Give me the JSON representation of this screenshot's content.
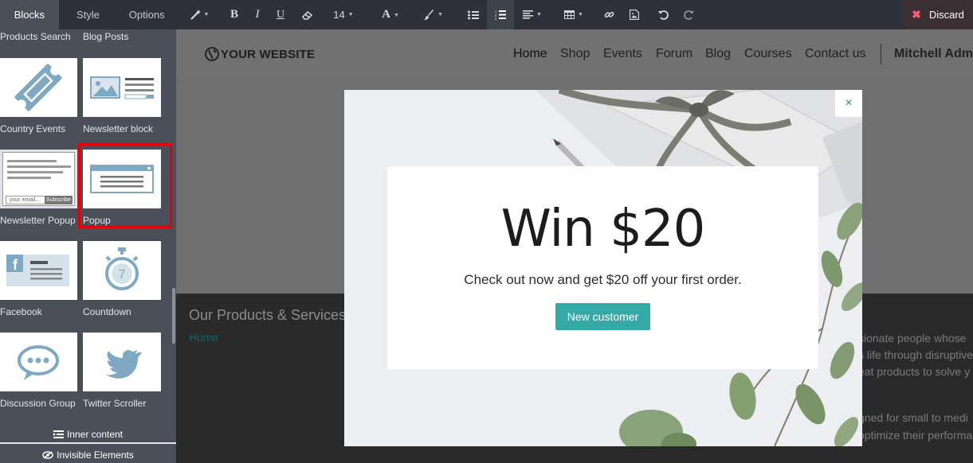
{
  "sidebar": {
    "tabs": [
      "Blocks",
      "Style",
      "Options"
    ],
    "snippets": [
      {
        "label": "Products Search"
      },
      {
        "label": "Blog Posts"
      },
      {
        "label": "Country Events"
      },
      {
        "label": "Newsletter block"
      },
      {
        "label": "Newsletter Popup",
        "email_placeholder": "your email...",
        "subscribe": "Subscribe"
      },
      {
        "label": "Popup"
      },
      {
        "label": "Facebook"
      },
      {
        "label": "Countdown"
      },
      {
        "label": "Discussion Group"
      },
      {
        "label": "Twitter Scroller"
      }
    ],
    "inner_content": "Inner content",
    "invisible_elements": "Invisible Elements"
  },
  "toolbar": {
    "font_size": "14",
    "discard": "Discard"
  },
  "site": {
    "logo": "YOUR WEBSITE",
    "nav": [
      "Home",
      "Shop",
      "Events",
      "Forum",
      "Blog",
      "Courses",
      "Contact us"
    ],
    "user": "Mitchell Admin",
    "section_title": "Our Products & Services",
    "breadcrumb": "Home",
    "side_text": [
      "sionate people whose",
      "s life through disruptive",
      "eat products to solve y",
      "gned for small to medi",
      "optimize their performa"
    ]
  },
  "popup": {
    "close": "×",
    "title": "Win $20",
    "subtitle": "Check out now and get $20 off your first order.",
    "button": "New customer"
  }
}
